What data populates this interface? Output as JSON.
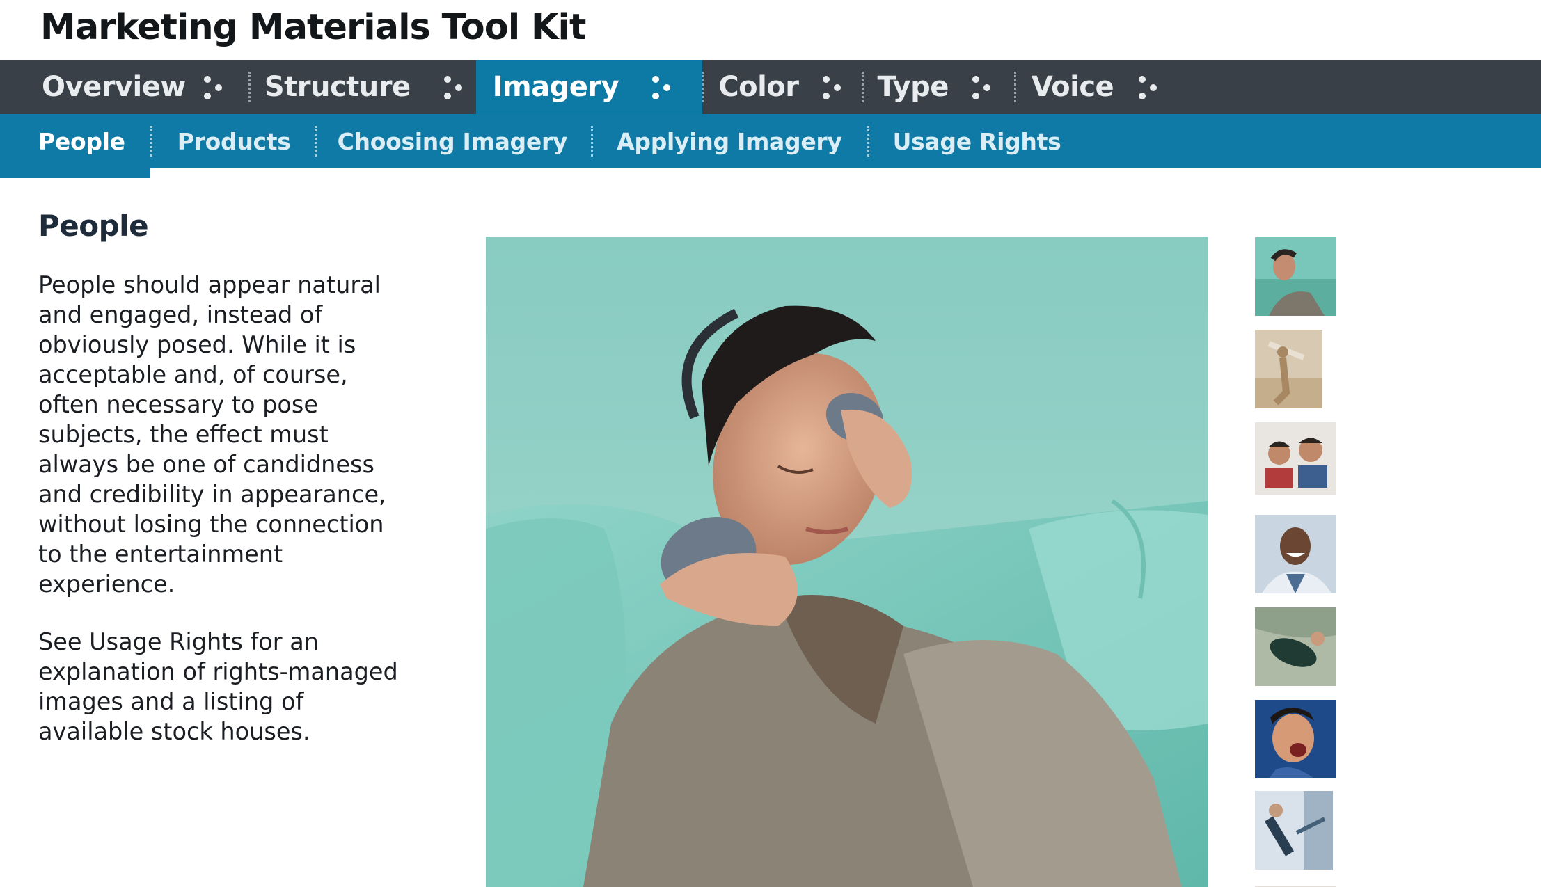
{
  "header": {
    "title": "Marketing Materials Tool Kit"
  },
  "primary_nav": [
    {
      "label": "Overview"
    },
    {
      "label": "Structure"
    },
    {
      "label": "Imagery",
      "active": true
    },
    {
      "label": "Color"
    },
    {
      "label": "Type"
    },
    {
      "label": "Voice"
    }
  ],
  "secondary_nav": [
    {
      "label": "People",
      "active": true
    },
    {
      "label": "Products"
    },
    {
      "label": "Choosing Imagery"
    },
    {
      "label": "Applying Imagery"
    },
    {
      "label": "Usage Rights"
    }
  ],
  "content": {
    "heading": "People",
    "paragraphs": [
      "People should appear natural and engaged, instead of obviously posed. While it is acceptable and, of course, often necessary to pose subjects, the effect must always be one of candidness and credibility in appearance, without losing the connection to the entertainment experience.",
      "See Usage Rights for an explanation of rights-managed images and a listing of available stock houses."
    ]
  },
  "colors": {
    "primary_nav_bg": "#3a4048",
    "active_bg": "#0d7aa6",
    "secondary_nav_bg": "#0e7aa5",
    "hero_bg": "#8fd0c6"
  }
}
